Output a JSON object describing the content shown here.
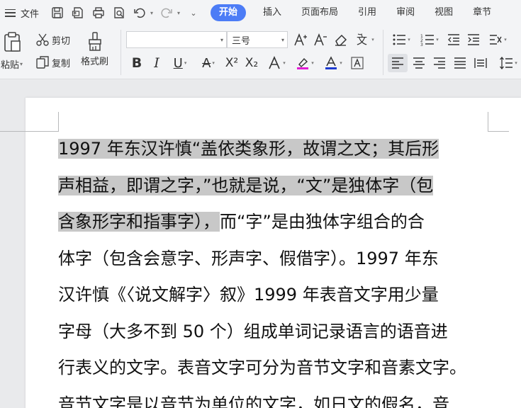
{
  "menubar": {
    "file_label": "文件",
    "tabs": [
      {
        "label": "开始",
        "active": true
      },
      {
        "label": "插入"
      },
      {
        "label": "页面布局"
      },
      {
        "label": "引用"
      },
      {
        "label": "审阅"
      },
      {
        "label": "视图"
      },
      {
        "label": "章节"
      }
    ],
    "accent": "#4c7cf6"
  },
  "ribbon": {
    "paste_label": "粘贴",
    "cut_label": "剪切",
    "copy_label": "复制",
    "format_painter_label": "格式刷",
    "font_name_value": "",
    "font_size_value": "三号",
    "font_color_accent": "#1d3bd1",
    "highlight_accent": "#e21bd4"
  },
  "document": {
    "selection_color": "#c8c8c8",
    "lines": [
      {
        "selected": "1997 年东汉许慎“盖依类象形，故谓之文；其后形",
        "rest": ""
      },
      {
        "selected": "声相益，即谓之字，”也就是说，“文”是独体字（包",
        "rest": ""
      },
      {
        "selected": "含象形字和指事字），",
        "rest": "而“字”是由独体字组合的合"
      },
      {
        "selected": "",
        "rest": "体字（包含会意字、形声字、假借字）。1997 年东"
      },
      {
        "selected": "",
        "rest": "汉许慎《〈说文解字〉叙》1999 年表音文字用少量"
      },
      {
        "selected": "",
        "rest": "字母（大多不到 50 个）组成单词记录语言的语音进"
      },
      {
        "selected": "",
        "rest": "行表义的文字。表音文字可分为音节文字和音素文字。"
      },
      {
        "selected": "",
        "rest": "音节文字是以音节为单位的文字，如日文的假名，音"
      }
    ]
  }
}
